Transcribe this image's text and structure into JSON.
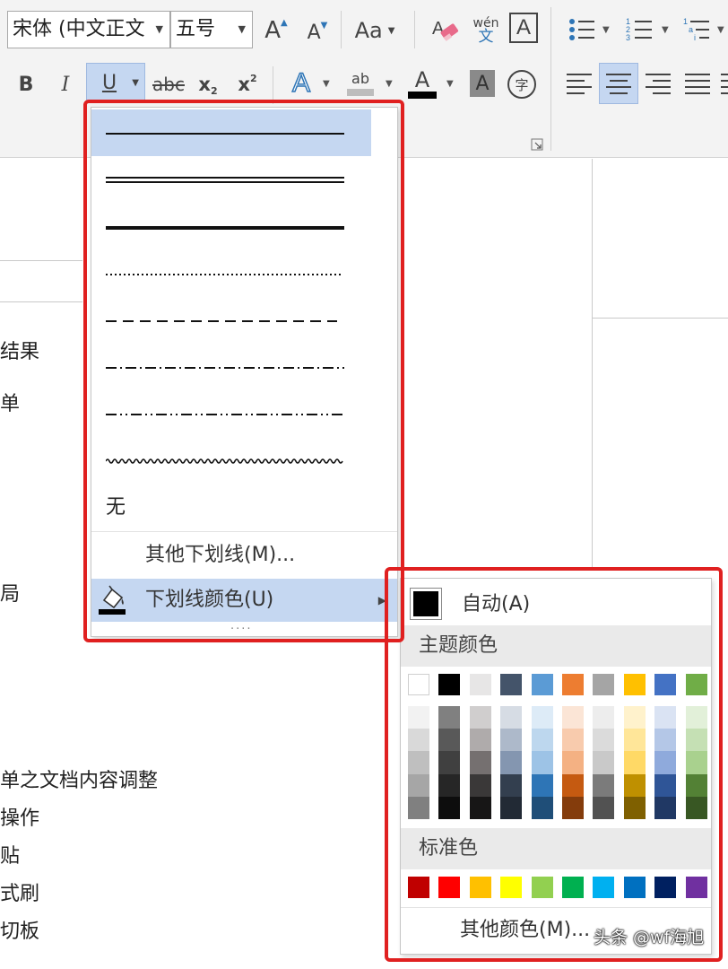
{
  "ribbon": {
    "font_name": "宋体 (中文正文",
    "font_size": "五号",
    "bold": "B",
    "italic": "I",
    "underline": "U",
    "strike": "abc",
    "subscript": "x",
    "subscript_mark": "2",
    "superscript": "x",
    "superscript_mark": "2",
    "grow": "A",
    "shrink": "A",
    "case": "Aa",
    "phonetic_top": "wén",
    "phonetic_bottom": "文",
    "border_char": "A",
    "text_effect": "A",
    "highlight": "ab",
    "font_color": "A",
    "shading_char": "A",
    "enclose_char": "字"
  },
  "underline_menu": {
    "styles": [
      "single",
      "double",
      "thick",
      "dotted",
      "dash",
      "dash-dot",
      "dash-dot-dot",
      "wave"
    ],
    "selected": "single",
    "none_label": "无",
    "more_label": "其他下划线(M)...",
    "color_label": "下划线颜色(U)",
    "grip": "....",
    "accent_highlight": "#c5d7f1"
  },
  "color_menu": {
    "auto_label": "自动(A)",
    "theme_label": "主题颜色",
    "theme_colors": [
      "#ffffff",
      "#000000",
      "#e7e6e6",
      "#44546a",
      "#5b9bd5",
      "#ed7d31",
      "#a5a5a5",
      "#ffc000",
      "#4472c4",
      "#70ad47"
    ],
    "theme_shades": [
      [
        "#f2f2f2",
        "#d9d9d9",
        "#bfbfbf",
        "#a6a6a6",
        "#808080"
      ],
      [
        "#808080",
        "#595959",
        "#404040",
        "#262626",
        "#0d0d0d"
      ],
      [
        "#d0cece",
        "#afabab",
        "#757070",
        "#3a3838",
        "#171616"
      ],
      [
        "#d6dce4",
        "#adb9ca",
        "#8496b0",
        "#333f4f",
        "#222a35"
      ],
      [
        "#ddebf7",
        "#bdd7ee",
        "#9dc3e6",
        "#2e75b6",
        "#1f4e78"
      ],
      [
        "#fbe5d6",
        "#f8cbad",
        "#f4b183",
        "#c55a11",
        "#843c0c"
      ],
      [
        "#ededed",
        "#dbdbdb",
        "#c9c9c9",
        "#7b7b7b",
        "#525252"
      ],
      [
        "#fff2cc",
        "#ffe699",
        "#ffd966",
        "#bf9000",
        "#7f6000"
      ],
      [
        "#dae3f3",
        "#b4c7e7",
        "#8faadc",
        "#2f5597",
        "#203864"
      ],
      [
        "#e2f0d9",
        "#c5e0b4",
        "#a9d18e",
        "#538135",
        "#385723"
      ]
    ],
    "standard_label": "标准色",
    "standard_colors": [
      "#c00000",
      "#ff0000",
      "#ffc000",
      "#ffff00",
      "#92d050",
      "#00b050",
      "#00b0f0",
      "#0070c0",
      "#002060",
      "#7030a0"
    ],
    "more_label": "其他颜色(M)..."
  },
  "document": {
    "lines": [
      "结果",
      "单",
      "局",
      "单之文档内容调整",
      "操作",
      "贴",
      "式刷",
      "切板"
    ]
  },
  "watermark": "头条 @wf海旭",
  "highlight_color": "#e02020"
}
